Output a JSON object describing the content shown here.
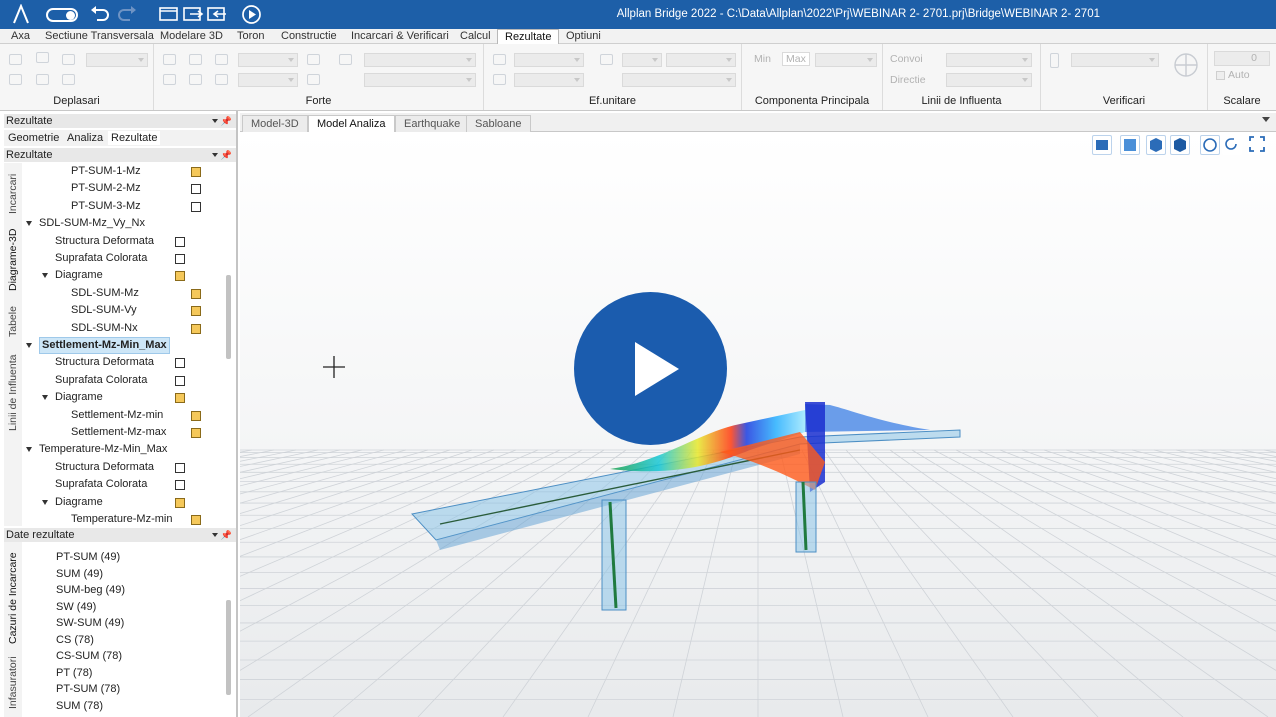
{
  "window": {
    "title": "Allplan Bridge 2022 - C:\\Data\\Allplan\\2022\\Prj\\WEBINAR 2- 2701.prj\\Bridge\\WEBINAR 2- 2701"
  },
  "menu": {
    "tabs": [
      "Axa",
      "Sectiune Transversala",
      "Modelare 3D",
      "Toron",
      "Constructie",
      "Incarcari & Verificari",
      "Calcul",
      "Rezultate",
      "Optiuni"
    ],
    "active": "Rezultate"
  },
  "ribbon": {
    "groups": [
      "Deplasari",
      "Forte",
      "Ef.unitare",
      "Componenta Principala",
      "Linii de Influenta",
      "Verificari",
      "Scalare"
    ],
    "min_label": "Min",
    "max_label": "Max",
    "convoi_label": "Convoi",
    "directie_label": "Directie",
    "scale_value": "0",
    "auto_label": "Auto"
  },
  "left_panel": {
    "top_header": "Rezultate",
    "subtabs": [
      "Geometrie",
      "Analiza",
      "Rezultate"
    ],
    "active_subtab": "Rezultate",
    "tree_header": "Rezultate",
    "vertical_tabs": [
      "Incarcari",
      "Diagrame-3D",
      "Tabele",
      "Linii de Influenta"
    ],
    "tree": [
      {
        "label": "PT-SUM-1-Mz",
        "level": 3,
        "expander": false,
        "check": "yellow"
      },
      {
        "label": "PT-SUM-2-Mz",
        "level": 3,
        "expander": false,
        "check": "empty"
      },
      {
        "label": "PT-SUM-3-Mz",
        "level": 3,
        "expander": false,
        "check": "empty"
      },
      {
        "label": "SDL-SUM-Mz_Vy_Nx",
        "level": 1,
        "expander": true,
        "check": "none"
      },
      {
        "label": "Structura Deformata",
        "level": 2,
        "expander": false,
        "check": "empty"
      },
      {
        "label": "Suprafata Colorata",
        "level": 2,
        "expander": false,
        "check": "empty"
      },
      {
        "label": "Diagrame",
        "level": 2,
        "expander": true,
        "check": "yellow"
      },
      {
        "label": "SDL-SUM-Mz",
        "level": 3,
        "expander": false,
        "check": "yellow"
      },
      {
        "label": "SDL-SUM-Vy",
        "level": 3,
        "expander": false,
        "check": "yellow"
      },
      {
        "label": "SDL-SUM-Nx",
        "level": 3,
        "expander": false,
        "check": "yellow"
      },
      {
        "label": "Settlement-Mz-Min_Max",
        "level": 1,
        "expander": true,
        "check": "none",
        "selected": true
      },
      {
        "label": "Structura Deformata",
        "level": 2,
        "expander": false,
        "check": "empty"
      },
      {
        "label": "Suprafata Colorata",
        "level": 2,
        "expander": false,
        "check": "empty"
      },
      {
        "label": "Diagrame",
        "level": 2,
        "expander": true,
        "check": "yellow"
      },
      {
        "label": "Settlement-Mz-min",
        "level": 3,
        "expander": false,
        "check": "yellow"
      },
      {
        "label": "Settlement-Mz-max",
        "level": 3,
        "expander": false,
        "check": "yellow"
      },
      {
        "label": "Temperature-Mz-Min_Max",
        "level": 1,
        "expander": true,
        "check": "none"
      },
      {
        "label": "Structura Deformata",
        "level": 2,
        "expander": false,
        "check": "empty"
      },
      {
        "label": "Suprafata Colorata",
        "level": 2,
        "expander": false,
        "check": "empty"
      },
      {
        "label": "Diagrame",
        "level": 2,
        "expander": true,
        "check": "yellow"
      },
      {
        "label": "Temperature-Mz-min",
        "level": 3,
        "expander": false,
        "check": "yellow"
      }
    ],
    "results_header": "Date rezultate",
    "results_vertical_tabs": [
      "Cazuri de Incarcare",
      "Infasuratori"
    ],
    "results_list": [
      "PT-SUM (49)",
      "SUM (49)",
      "SUM-beg (49)",
      "SW (49)",
      "SW-SUM (49)",
      "CS (78)",
      "CS-SUM (78)",
      "PT (78)",
      "PT-SUM (78)",
      "SUM (78)"
    ]
  },
  "view_tabs": {
    "tabs": [
      "Model-3D",
      "Model Analiza",
      "Earthquake",
      "Sabloane"
    ],
    "active": "Model Analiza"
  },
  "colors": {
    "titlebar": "#1d5fa8",
    "play_button": "#1b5cae",
    "selected_row": "#cde6f7",
    "check_yellow": "#f5c85a"
  }
}
